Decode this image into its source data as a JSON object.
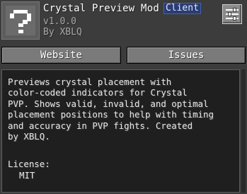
{
  "header": {
    "mod_name": "Crystal Preview Mod",
    "badge": "Client",
    "version": "v1.0.0",
    "author": "By XBLQ",
    "icon": "question-mark-icon",
    "config_icon": "sliders-icon"
  },
  "buttons": {
    "website": "Website",
    "issues": "Issues"
  },
  "description": {
    "text": "Previews crystal placement with\ncolor-coded indicators for Crystal\nPVP. Shows valid, invalid, and optimal\nplacement positions to help with timing\nand accuracy in PVP fights. Created\nby XBLQ.",
    "license_label": "License:",
    "license_value": "MIT"
  },
  "colors": {
    "badge_bg": "#2a3c73",
    "panel_bg": "#3c3c3c",
    "desc_bg": "#1f1f1f"
  }
}
